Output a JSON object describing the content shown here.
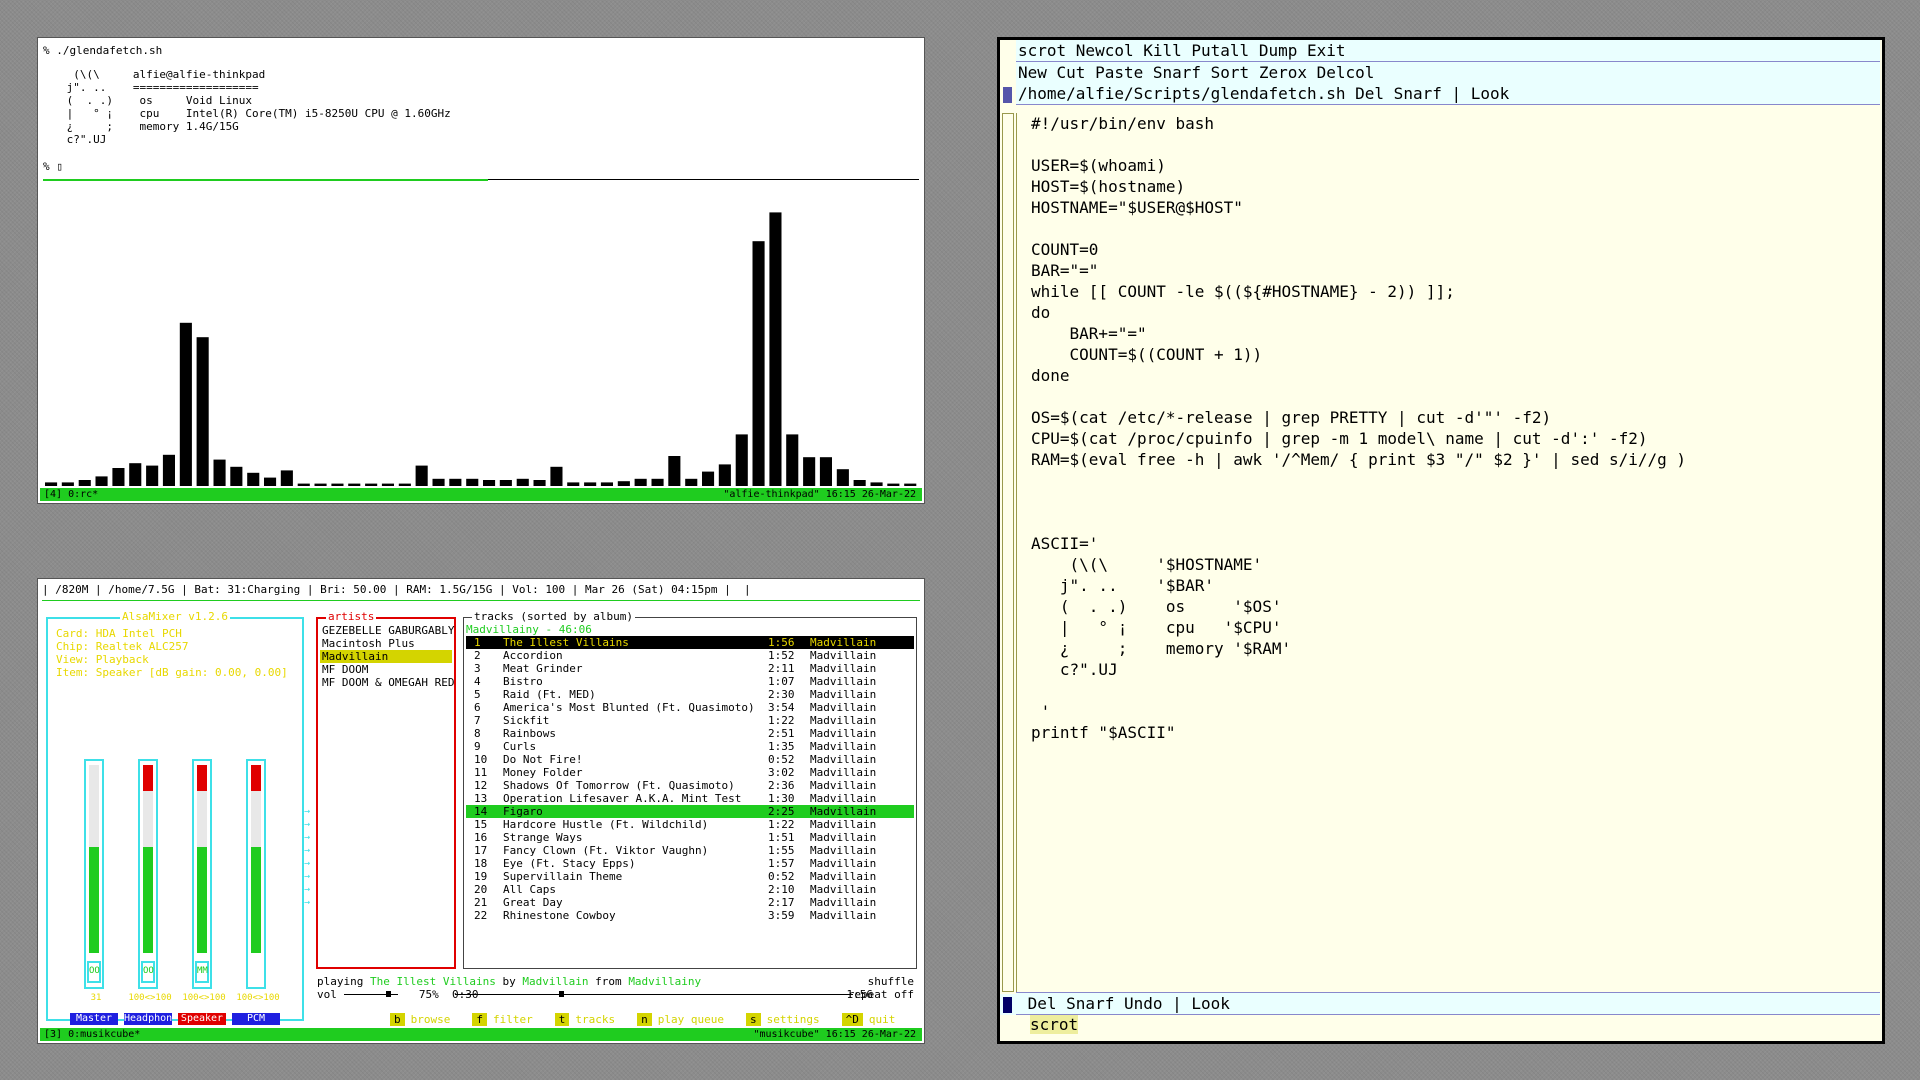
{
  "term1": {
    "command": "% ./glendafetch.sh",
    "fetch": [
      "  (\\(\\     alfie@alfie-thinkpad",
      " j\". ..    ===================",
      " (  . .)    os     Void Linux",
      " |   ° ¡    cpu    Intel(R) Core(TM) i5-8250U CPU @ 1.60GHz",
      " ¿     ;    memory 1.4G/15G",
      " c?\".UJ"
    ],
    "prompt": "% ▯",
    "visualizer": [
      3,
      3,
      5,
      8,
      15,
      19,
      17,
      26,
      136,
      124,
      22,
      16,
      11,
      7,
      13,
      2,
      2,
      2,
      2,
      2,
      2,
      2,
      17,
      6,
      6,
      6,
      5,
      5,
      6,
      5,
      16,
      3,
      3,
      3,
      4,
      6,
      6,
      25,
      6,
      12,
      18,
      43,
      204,
      228,
      43,
      24,
      24,
      14,
      5,
      3,
      2,
      2
    ],
    "status_left": "[4] 0:rc*",
    "status_right": "\"alfie-thinkpad\" 16:15 26-Mar-22"
  },
  "term2": {
    "topbar": "| /820M | /home/7.5G | Bat: 31:Charging | Bri: 50.00 | RAM: 1.5G/15G | Vol: 100 | Mar 26 (Sat) 04:15pm |  |",
    "alsa": {
      "title": "AlsaMixer v1.2.6",
      "info": [
        "Card: HDA Intel PCH",
        "Chip: Realtek ALC257",
        "View: Playback",
        "Item: Speaker [dB gain: 0.00, 0.00]"
      ],
      "channels": [
        {
          "label": "Master",
          "percent": "31",
          "switch": "OO",
          "fill": 0.55,
          "red": false
        },
        {
          "label": "Headphon",
          "percent": "100<>100",
          "switch": "OO",
          "fill": 0.55,
          "red": true
        },
        {
          "label": "Speaker",
          "percent": "100<>100",
          "switch": "MM",
          "fill": 0.55,
          "red": true
        },
        {
          "label": "PCM",
          "percent": "100<>100",
          "switch": "",
          "fill": 0.55,
          "red": true
        }
      ]
    },
    "artists": {
      "title": "artists",
      "items": [
        "GEZEBELLE GABURGABLY",
        "Macintosh Plus",
        "Madvillain",
        "MF DOOM",
        "MF DOOM & OMEGAH RED"
      ]
    },
    "tracks": {
      "title": "tracks (sorted by album)",
      "album": "Madvillainy - 46:06",
      "rows": [
        {
          "n": "1",
          "t": "The Illest Villains",
          "d": "1:56",
          "a": "Madvillain"
        },
        {
          "n": "2",
          "t": "Accordion",
          "d": "1:52",
          "a": "Madvillain"
        },
        {
          "n": "3",
          "t": "Meat Grinder",
          "d": "2:11",
          "a": "Madvillain"
        },
        {
          "n": "4",
          "t": "Bistro",
          "d": "1:07",
          "a": "Madvillain"
        },
        {
          "n": "5",
          "t": "Raid (Ft. MED)",
          "d": "2:30",
          "a": "Madvillain"
        },
        {
          "n": "6",
          "t": "America's Most Blunted (Ft. Quasimoto)",
          "d": "3:54",
          "a": "Madvillain"
        },
        {
          "n": "7",
          "t": "Sickfit",
          "d": "1:22",
          "a": "Madvillain"
        },
        {
          "n": "8",
          "t": "Rainbows",
          "d": "2:51",
          "a": "Madvillain"
        },
        {
          "n": "9",
          "t": "Curls",
          "d": "1:35",
          "a": "Madvillain"
        },
        {
          "n": "10",
          "t": "Do Not Fire!",
          "d": "0:52",
          "a": "Madvillain"
        },
        {
          "n": "11",
          "t": "Money Folder",
          "d": "3:02",
          "a": "Madvillain"
        },
        {
          "n": "12",
          "t": "Shadows Of Tomorrow (Ft. Quasimoto)",
          "d": "2:36",
          "a": "Madvillain"
        },
        {
          "n": "13",
          "t": "Operation Lifesaver A.K.A. Mint Test",
          "d": "1:30",
          "a": "Madvillain"
        },
        {
          "n": "14",
          "t": "Figaro",
          "d": "2:25",
          "a": "Madvillain"
        },
        {
          "n": "15",
          "t": "Hardcore Hustle (Ft. Wildchild)",
          "d": "1:22",
          "a": "Madvillain"
        },
        {
          "n": "16",
          "t": "Strange Ways",
          "d": "1:51",
          "a": "Madvillain"
        },
        {
          "n": "17",
          "t": "Fancy Clown (Ft. Viktor Vaughn)",
          "d": "1:55",
          "a": "Madvillain"
        },
        {
          "n": "18",
          "t": "Eye (Ft. Stacy Epps)",
          "d": "1:57",
          "a": "Madvillain"
        },
        {
          "n": "19",
          "t": "Supervillain Theme",
          "d": "0:52",
          "a": "Madvillain"
        },
        {
          "n": "20",
          "t": "All Caps",
          "d": "2:10",
          "a": "Madvillain"
        },
        {
          "n": "21",
          "t": "Great Day",
          "d": "2:17",
          "a": "Madvillain"
        },
        {
          "n": "22",
          "t": "Rhinestone Cowboy",
          "d": "3:59",
          "a": "Madvillain"
        }
      ]
    },
    "playing": {
      "prefix": "playing ",
      "track": "The Illest Villains",
      "by": " by ",
      "artist": "Madvillain",
      "from": " from ",
      "album": "Madvillainy",
      "shuffle": "shuffle",
      "vol_label": "vol",
      "vol_value": "75%",
      "elapsed": "0:30",
      "total": "1:56",
      "repeat": "repeat off"
    },
    "menu": [
      {
        "key": "b",
        "label": "browse"
      },
      {
        "key": "f",
        "label": "filter"
      },
      {
        "key": "t",
        "label": "tracks"
      },
      {
        "key": "n",
        "label": "play queue"
      },
      {
        "key": "s",
        "label": "settings"
      },
      {
        "key": "^D",
        "label": "quit"
      }
    ],
    "status_left": "[3] 0:musikcube*",
    "status_right": "\"musikcube\" 16:15 26-Mar-22"
  },
  "acme": {
    "tag_main": "scrot Newcol Kill Putall Dump Exit",
    "tag_col": "New Cut Paste Snarf Sort Zerox Delcol",
    "tag_win": "/home/alfie/Scripts/glendafetch.sh Del Snarf | Look",
    "body": [
      "#!/usr/bin/env bash",
      "",
      "USER=$(whoami)",
      "HOST=$(hostname)",
      "HOSTNAME=\"$USER@$HOST\"",
      "",
      "COUNT=0",
      "BAR=\"=\"",
      "while [[ COUNT -le $((${#HOSTNAME} - 2)) ]];",
      "do",
      "    BAR+=\"=\"",
      "    COUNT=$((COUNT + 1))",
      "done",
      "",
      "OS=$(cat /etc/*-release | grep PRETTY | cut -d'\"' -f2)",
      "CPU=$(cat /proc/cpuinfo | grep -m 1 model\\ name | cut -d':' -f2)",
      "RAM=$(eval free -h | awk '/^Mem/ { print $3 \"/\" $2 }' | sed s/i//g )",
      "",
      "",
      "",
      "ASCII='",
      "    (\\(\\     '$HOSTNAME'",
      "   j\". ..    '$BAR'",
      "   (  . .)    os     '$OS'",
      "   |   ° ¡    cpu   '$CPU'",
      "   ¿     ;    memory '$RAM'",
      "   c?\".UJ",
      "",
      " '",
      "printf \"$ASCII\""
    ],
    "tag_bottom": " Del Snarf Undo | Look",
    "bottom_body": "scrot"
  }
}
